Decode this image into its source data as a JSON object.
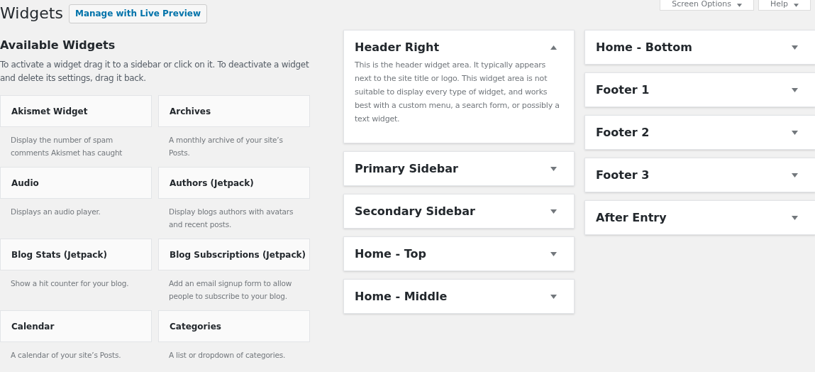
{
  "page_title": "Widgets",
  "live_preview_button": "Manage with Live Preview",
  "screen_meta_buttons": [
    {
      "label": "Screen Options",
      "expanded": false
    },
    {
      "label": "Help",
      "expanded": false
    }
  ],
  "available_widgets": {
    "heading": "Available Widgets",
    "description": "To activate a widget drag it to a sidebar or click on it. To deactivate a widget and delete its settings, drag it back.",
    "widgets": [
      {
        "name": "Akismet Widget",
        "description": "Display the number of spam comments Akismet has caught"
      },
      {
        "name": "Archives",
        "description": "A monthly archive of your site’s Posts."
      },
      {
        "name": "Audio",
        "description": "Displays an audio player."
      },
      {
        "name": "Authors (Jetpack)",
        "description": "Display blogs authors with avatars and recent posts."
      },
      {
        "name": "Blog Stats (Jetpack)",
        "description": "Show a hit counter for your blog."
      },
      {
        "name": "Blog Subscriptions (Jetpack)",
        "description": "Add an email signup form to allow people to subscribe to your blog."
      },
      {
        "name": "Calendar",
        "description": "A calendar of your site’s Posts."
      },
      {
        "name": "Categories",
        "description": "A list or dropdown of categories."
      }
    ]
  },
  "sidebar_columns": [
    [
      {
        "name": "Header Right",
        "expanded": true,
        "description": "This is the header widget area. It typically appears next to the site title or logo. This widget area is not suitable to display every type of widget, and works best with a custom menu, a search form, or possibly a text widget."
      },
      {
        "name": "Primary Sidebar",
        "expanded": false
      },
      {
        "name": "Secondary Sidebar",
        "expanded": false
      },
      {
        "name": "Home - Top",
        "expanded": false
      },
      {
        "name": "Home - Middle",
        "expanded": false
      }
    ],
    [
      {
        "name": "Home - Bottom",
        "expanded": false
      },
      {
        "name": "Footer 1",
        "expanded": false
      },
      {
        "name": "Footer 2",
        "expanded": false
      },
      {
        "name": "Footer 3",
        "expanded": false
      },
      {
        "name": "After Entry",
        "expanded": false
      }
    ]
  ]
}
